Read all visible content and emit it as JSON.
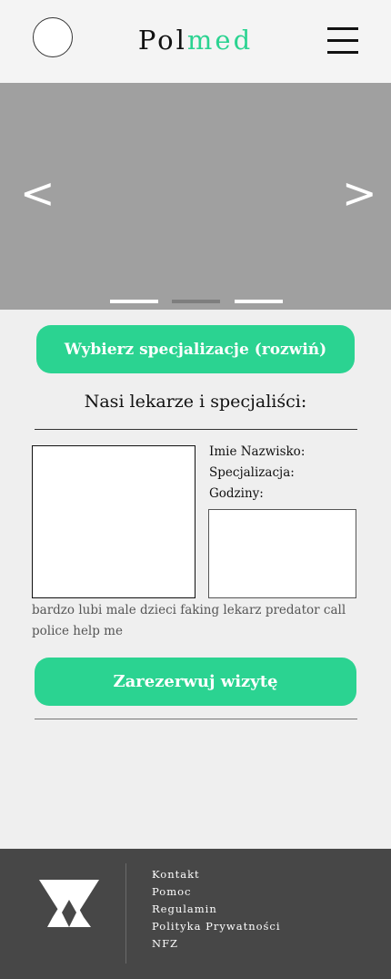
{
  "header": {
    "brand_part1": "Pol",
    "brand_part2": "med",
    "avatar_icon": "avatar-circle",
    "menu_icon": "hamburger-icon"
  },
  "slider": {
    "prev_label": "<",
    "next_label": ">",
    "active_slide": 2,
    "slide_count": 3
  },
  "specialization_button": "Wybierz specjalizacje (rozwiń)",
  "section_title": "Nasi lekarze i specjaliści:",
  "doctor": {
    "name_label": "Imie Nazwisko:",
    "specialization_label": "Specjalizacja:",
    "hours_label": "Godziny:",
    "description": "bardzo lubi male dzieci faking lekarz predator call police help me"
  },
  "book_button": "Zarezerwuj wizytę",
  "footer": {
    "links": [
      "Kontakt",
      "Pomoc",
      "Regulamin",
      "Polityka Prywatności",
      "NFZ"
    ]
  },
  "colors": {
    "accent": "#2bd391",
    "slider_bg": "#a0a0a0",
    "footer_bg": "#474747",
    "page_bg": "#efefef"
  }
}
